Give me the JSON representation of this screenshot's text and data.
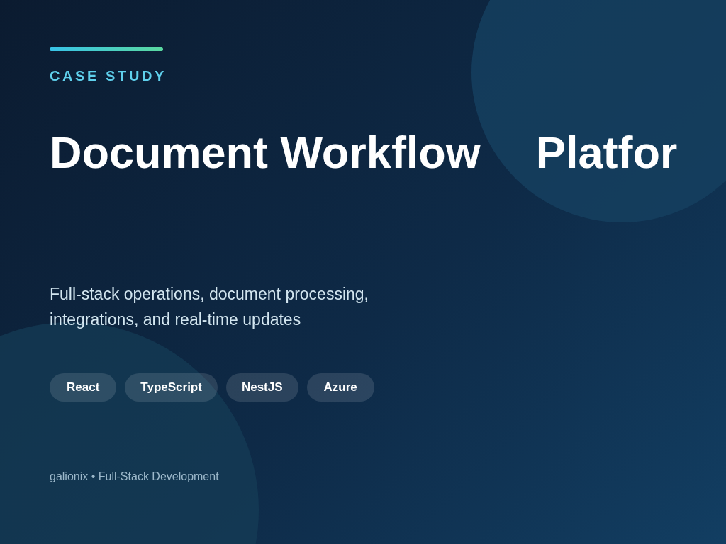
{
  "eyebrow": "CASE STUDY",
  "title": [
    "Document Workflow",
    "Platfor"
  ],
  "subtitle": [
    "Full-stack operations, document processing,",
    "integrations, and real-time updates"
  ],
  "tags": [
    "React",
    "TypeScript",
    "NestJS",
    "Azure"
  ],
  "footer": "galionix • Full-Stack Development"
}
